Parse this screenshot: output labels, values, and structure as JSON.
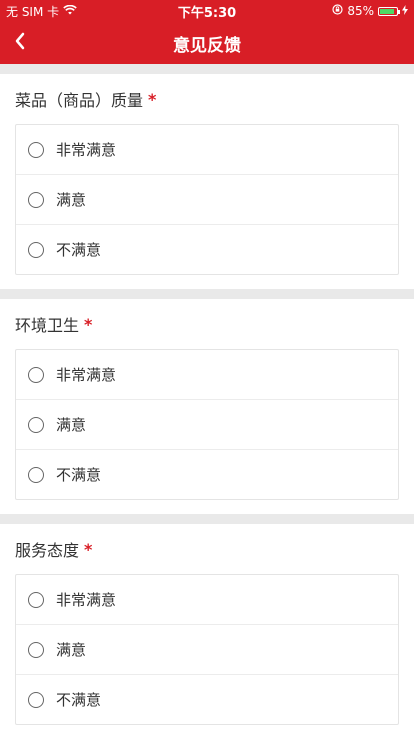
{
  "status_bar": {
    "carrier": "无 SIM 卡",
    "time": "下午5:30",
    "battery": "85%"
  },
  "nav": {
    "title": "意见反馈"
  },
  "sections": [
    {
      "title": "菜品（商品）质量",
      "required": "*",
      "options": [
        "非常满意",
        "满意",
        "不满意"
      ]
    },
    {
      "title": "环境卫生",
      "required": "*",
      "options": [
        "非常满意",
        "满意",
        "不满意"
      ]
    },
    {
      "title": "服务态度",
      "required": "*",
      "options": [
        "非常满意",
        "满意",
        "不满意"
      ]
    }
  ],
  "colors": {
    "brand": "#d81e26",
    "battery": "#4cd964"
  }
}
